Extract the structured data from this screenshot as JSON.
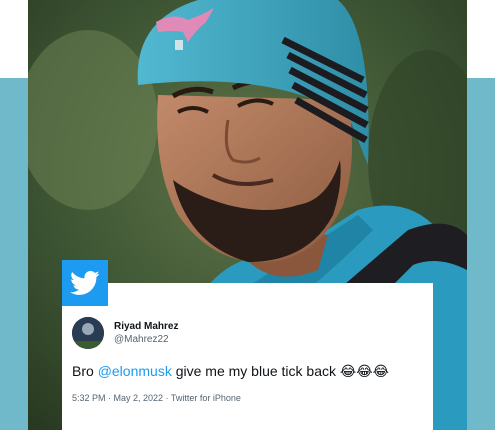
{
  "tweet": {
    "display_name": "Riyad Mahrez",
    "handle": "@Mahrez22",
    "text_prefix": "Bro ",
    "mention": "@elonmusk",
    "text_suffix": " give me my blue tick back ",
    "emojis": "😂😂😂",
    "meta": "5:32 PM · May 2, 2022 · Twitter for iPhone"
  },
  "icons": {
    "badge": "twitter-bird-icon"
  },
  "colors": {
    "twitter_blue": "#1d9bf0",
    "frame_teal": "#6fb9cb",
    "beanie_blue": "#3fa9c4"
  }
}
